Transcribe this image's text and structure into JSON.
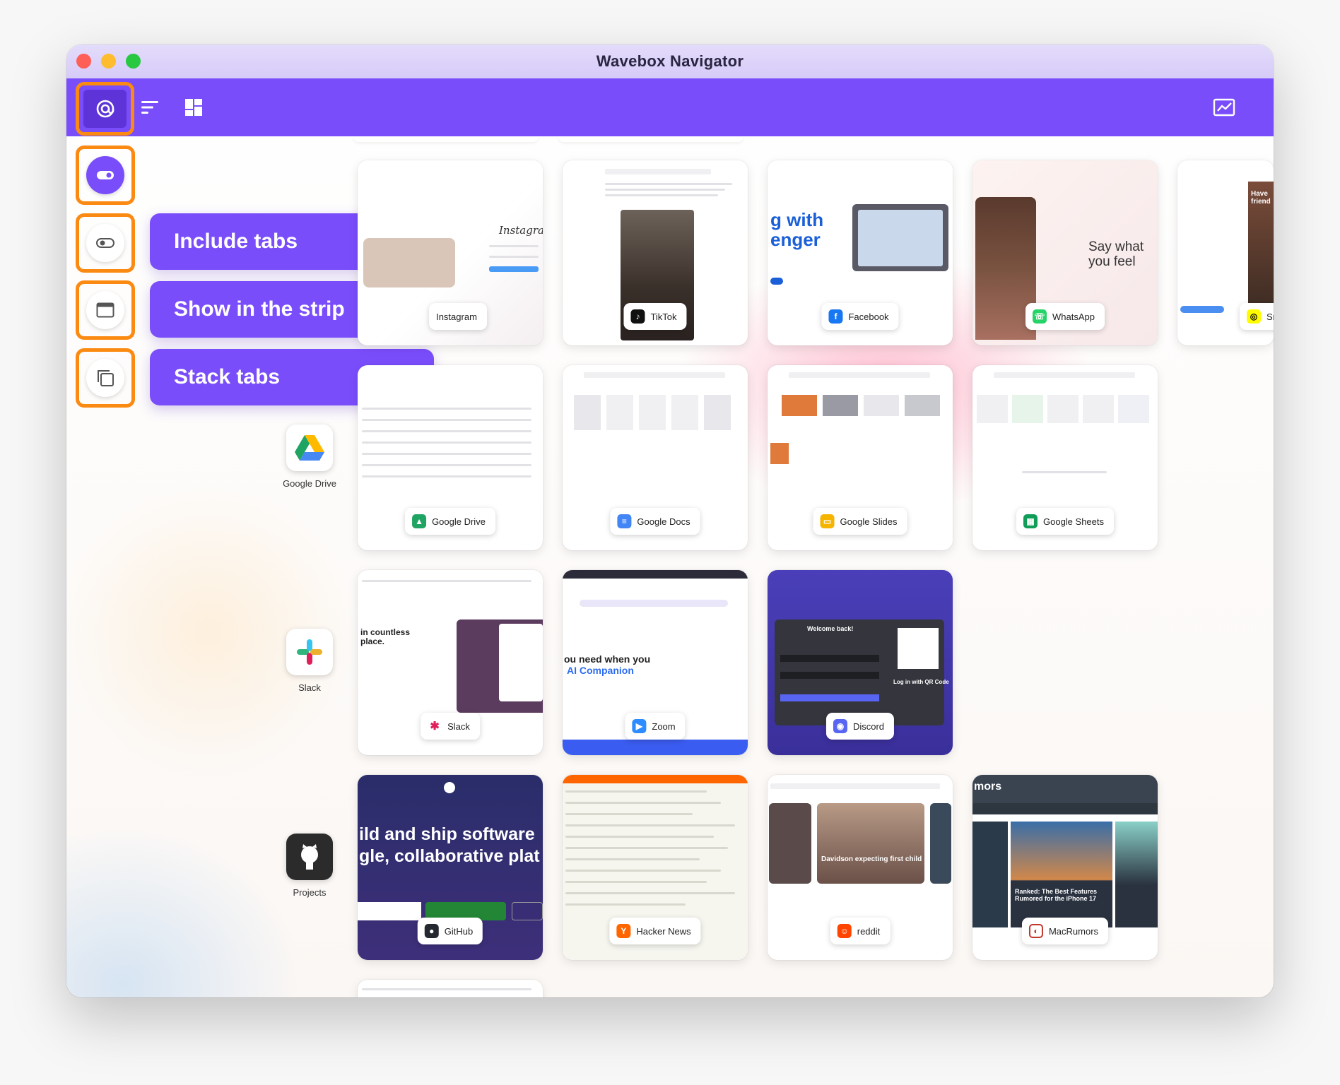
{
  "window": {
    "title": "Wavebox Navigator"
  },
  "toolbar": {
    "main_icon": "at-target-icon",
    "sort_icon": "sort-lines-icon",
    "grid_icon": "grid-layout-icon",
    "stats_icon": "trend-chart-icon"
  },
  "sidebar": {
    "options": [
      {
        "label": "Include tabs",
        "icon": "toggle-icon"
      },
      {
        "label": "Show in the strip",
        "icon": "window-icon"
      },
      {
        "label": "Stack tabs",
        "icon": "stack-icon"
      }
    ]
  },
  "groups": [
    {
      "label": "Google Drive",
      "icon": "google-drive-icon"
    },
    {
      "label": "Slack",
      "icon": "slack-icon"
    },
    {
      "label": "Projects",
      "icon": "github-icon"
    }
  ],
  "cards": {
    "row1": [
      {
        "label": "Instagram",
        "icon_color": "#d62976",
        "thumb_text": "Instagram"
      },
      {
        "label": "TikTok",
        "icon_color": "#111111",
        "thumb_text": ""
      },
      {
        "label": "Facebook",
        "icon_color": "#1877f2",
        "thumb_text": "g with enger"
      },
      {
        "label": "WhatsApp",
        "icon_color": "#25d366",
        "thumb_text": "Say what you feel"
      },
      {
        "label": "Sna",
        "icon_color": "#fffc00",
        "thumb_text": "Have friend"
      }
    ],
    "row2": [
      {
        "label": "Google Drive",
        "icon_color": "#1fa463"
      },
      {
        "label": "Google Docs",
        "icon_color": "#4285f4"
      },
      {
        "label": "Google Slides",
        "icon_color": "#f4b400"
      },
      {
        "label": "Google Sheets",
        "icon_color": "#0f9d58"
      }
    ],
    "row3": [
      {
        "label": "Slack",
        "icon_color": "#4a154b",
        "thumb_text": "in countless place."
      },
      {
        "label": "Zoom",
        "icon_color": "#2d8cff",
        "thumb_text": "ou need when you",
        "thumb_text2": "AI Companion"
      },
      {
        "label": "Discord",
        "icon_color": "#5865f2",
        "thumb_text": "Welcome back!",
        "thumb_text2": "Log in with QR Code"
      }
    ],
    "row4": [
      {
        "label": "GitHub",
        "icon_color": "#24292f",
        "thumb_text": "ild and ship software",
        "thumb_text2": "gle, collaborative plat"
      },
      {
        "label": "Hacker News",
        "icon_color": "#ff6600"
      },
      {
        "label": "reddit",
        "icon_color": "#ff4500",
        "thumb_text": "Davidson expecting first child"
      },
      {
        "label": "MacRumors",
        "icon_color": "#c0392b",
        "thumb_text": "mors",
        "thumb_text2": "Ranked: The Best Features Rumored for the iPhone 17"
      }
    ]
  }
}
